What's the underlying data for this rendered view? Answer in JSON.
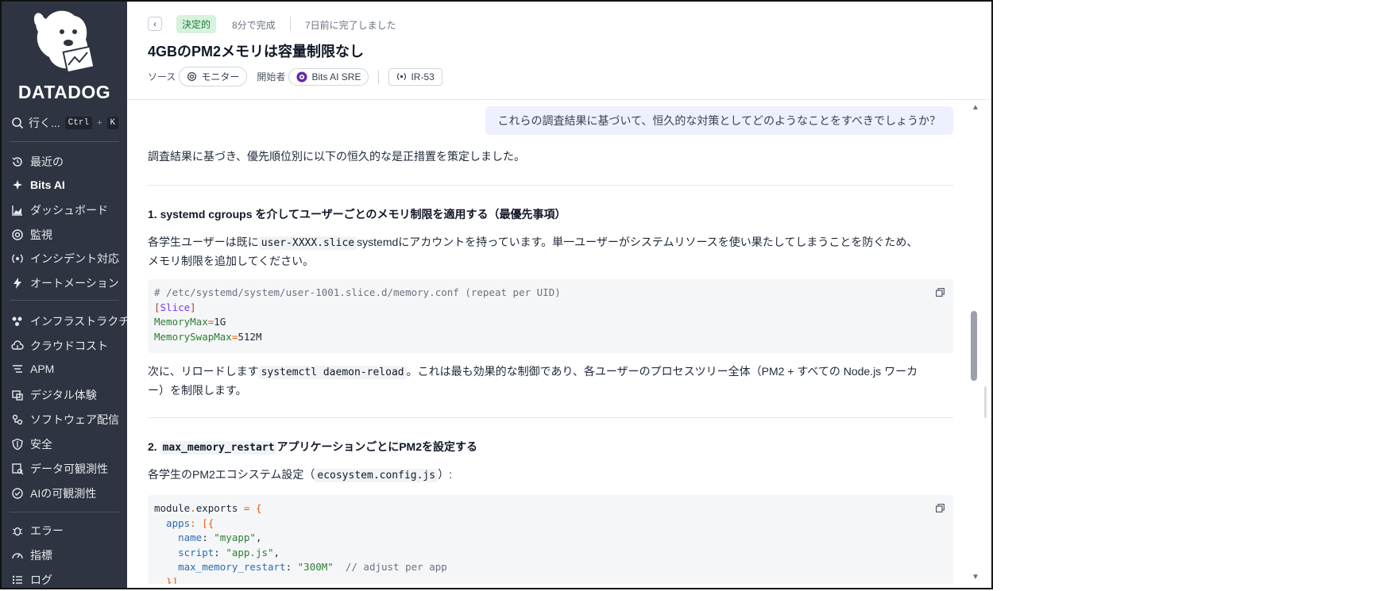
{
  "sidebar": {
    "logo_text": "DATADOG",
    "goto": {
      "label": "行く...",
      "key1": "Ctrl",
      "plus": "+",
      "key2": "K"
    },
    "items": [
      {
        "label": "最近の",
        "icon": "history-icon"
      },
      {
        "label": "Bits AI",
        "icon": "sparkle-icon",
        "active": true
      },
      {
        "label": "ダッシュボード",
        "icon": "chart-area-icon"
      },
      {
        "label": "監視",
        "icon": "monitor-icon"
      },
      {
        "label": "インシデント対応",
        "icon": "incident-icon"
      },
      {
        "label": "オートメーション",
        "icon": "bolt-icon"
      },
      {
        "label": "インフラストラクチャ",
        "icon": "infrastructure-icon"
      },
      {
        "label": "クラウドコスト",
        "icon": "cloud-cost-icon"
      },
      {
        "label": "APM",
        "icon": "apm-icon"
      },
      {
        "label": "デジタル体験",
        "icon": "digital-experience-icon"
      },
      {
        "label": "ソフトウェア配信",
        "icon": "software-delivery-icon"
      },
      {
        "label": "安全",
        "icon": "shield-icon"
      },
      {
        "label": "データ可観測性",
        "icon": "data-observability-icon"
      },
      {
        "label": "AIの可観測性",
        "icon": "ai-observability-icon"
      },
      {
        "label": "エラー",
        "icon": "bug-icon"
      },
      {
        "label": "指標",
        "icon": "gauge-icon"
      },
      {
        "label": "ログ",
        "icon": "logs-icon"
      }
    ]
  },
  "header": {
    "status_badge": "決定的",
    "duration": "8分で完成",
    "completed": "7日前に完了しました",
    "title": "4GBのPM2メモリは容量制限なし",
    "source_label": "ソース",
    "source_value": "モニター",
    "initiator_label": "開始者",
    "initiator_value": "Bits AI SRE",
    "incident_id": "IR-53"
  },
  "conversation": {
    "user_message": "これらの調査結果に基づいて、恒久的な対策としてどのようなことをすべきでしょうか？",
    "intro": "調査結果に基づき、優先順位別に以下の恒久的な是正措置を策定しました。",
    "section1": {
      "heading": "1. systemd cgroups を介してユーザーごとのメモリ制限を適用する（最優先事項）",
      "para_a": "各学生ユーザーは既に",
      "para_code": "user-XXXX.slice",
      "para_b": "systemdにアカウントを持っています。単一ユーザーがシステムリソースを使い果たしてしまうことを防ぐため、",
      "para_c": "メモリ制限を追加してください。",
      "code_comment": "# /etc/systemd/system/user-1001.slice.d/memory.conf (repeat per UID)",
      "code_lb": "[",
      "code_section": "Slice",
      "code_rb": "]",
      "code_key1": "MemoryMax",
      "code_eq": "=",
      "code_val1": "1G",
      "code_key2": "MemorySwapMax",
      "code_val2": "512M",
      "after_a": "次に、リロードします",
      "after_code": "systemctl daemon-reload",
      "after_b": "。これは最も効果的な制御であり、各ユーザーのプロセスツリー全体（PM2 + すべての Node.js ワーカ",
      "after_c": "ー）を制限します。"
    },
    "section2": {
      "heading_num": "2.",
      "heading_code": "max_memory_restart",
      "heading_text": "アプリケーションごとにPM2を設定する",
      "para_a": "各学生のPM2エコシステム設定（",
      "para_code": "ecosystem.config.js",
      "para_b": "）:",
      "l1_a": "module",
      "l1_b": ".",
      "l1_c": "exports",
      "l1_d": " = {",
      "l2_a": "  apps",
      "l2_b": ": [{",
      "l3_key": "    name",
      "l3_colon": ": ",
      "l3_val": "\"myapp\"",
      "l3_comma": ",",
      "l4_key": "    script",
      "l4_val": "\"app.js\"",
      "l5_key": "    max_memory_restart",
      "l5_val": "\"300M\"",
      "l5_comment": "  // adjust per app",
      "l6": "  }]"
    }
  }
}
